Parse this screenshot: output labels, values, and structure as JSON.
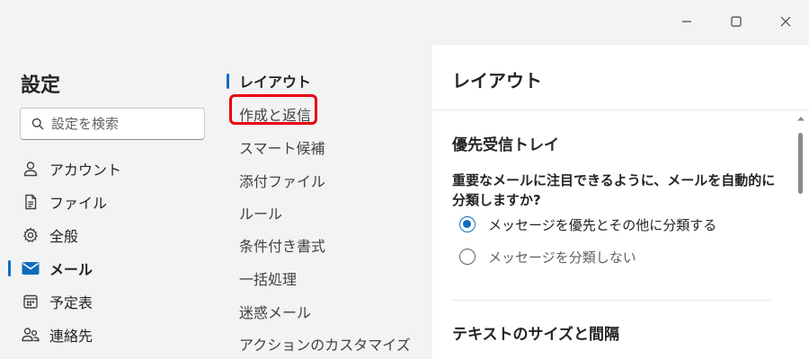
{
  "window": {
    "controls": [
      "minimize",
      "maximize",
      "close"
    ]
  },
  "sidebar": {
    "title": "設定",
    "search_placeholder": "設定を検索",
    "items": [
      {
        "label": "アカウント",
        "icon": "person-icon",
        "active": false
      },
      {
        "label": "ファイル",
        "icon": "file-icon",
        "active": false
      },
      {
        "label": "全般",
        "icon": "gear-icon",
        "active": false
      },
      {
        "label": "メール",
        "icon": "mail-icon",
        "active": true
      },
      {
        "label": "予定表",
        "icon": "calendar-icon",
        "active": false
      },
      {
        "label": "連絡先",
        "icon": "people-icon",
        "active": false
      }
    ]
  },
  "subnav": {
    "items": [
      {
        "label": "レイアウト",
        "active": true
      },
      {
        "label": "作成と返信",
        "active": false,
        "highlighted": true
      },
      {
        "label": "スマート候補",
        "active": false
      },
      {
        "label": "添付ファイル",
        "active": false
      },
      {
        "label": "ルール",
        "active": false
      },
      {
        "label": "条件付き書式",
        "active": false
      },
      {
        "label": "一括処理",
        "active": false
      },
      {
        "label": "迷惑メール",
        "active": false
      },
      {
        "label": "アクションのカスタマイズ",
        "active": false
      }
    ]
  },
  "content": {
    "title": "レイアウト",
    "focused_inbox": {
      "heading": "優先受信トレイ",
      "question": "重要なメールに注目できるように、メールを自動的に分類しますか?",
      "options": [
        {
          "label": "メッセージを優先とその他に分類する",
          "checked": true
        },
        {
          "label": "メッセージを分類しない",
          "checked": false
        }
      ]
    },
    "text_size": {
      "heading": "テキストのサイズと間隔"
    }
  },
  "colors": {
    "accent": "#0f6cbd",
    "highlight": "#e8000d",
    "background": "#f3f3f3",
    "panel": "#ffffff"
  }
}
